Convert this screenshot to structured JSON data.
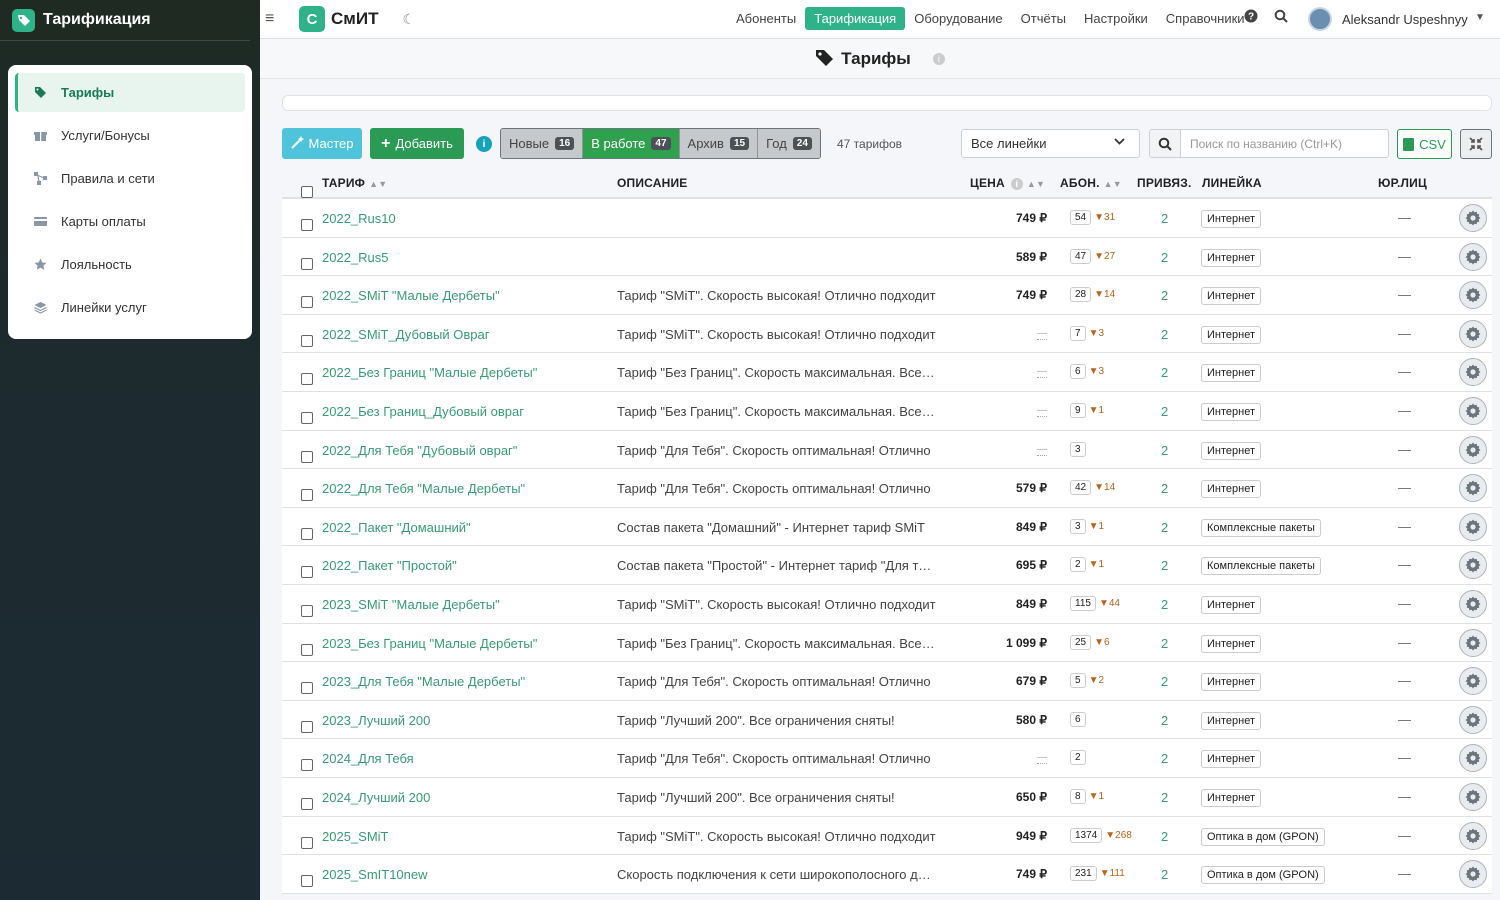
{
  "app": {
    "title": "Тарификация",
    "logo_letter": "С",
    "logo_text": "СмИТ"
  },
  "sidebar": {
    "items": [
      {
        "label": "Тарифы",
        "icon": "tag-icon",
        "active": true
      },
      {
        "label": "Услуги/Бонусы",
        "icon": "gift-icon"
      },
      {
        "label": "Правила и сети",
        "icon": "network-icon"
      },
      {
        "label": "Карты оплаты",
        "icon": "card-icon"
      },
      {
        "label": "Лояльность",
        "icon": "star-icon"
      },
      {
        "label": "Линейки услуг",
        "icon": "layers-icon"
      }
    ]
  },
  "nav": {
    "links": [
      "Абоненты",
      "Тарификация",
      "Оборудование",
      "Отчёты",
      "Настройки",
      "Справочники"
    ],
    "active": "Тарификация",
    "user": "Aleksandr Uspeshnyy"
  },
  "page": {
    "title": "Тарифы"
  },
  "toolbar": {
    "master_label": "Мастер",
    "add_label": "Добавить",
    "segments": [
      {
        "label": "Новые",
        "count": "16"
      },
      {
        "label": "В работе",
        "count": "47",
        "active": true
      },
      {
        "label": "Архив",
        "count": "15"
      },
      {
        "label": "Год",
        "count": "24"
      }
    ],
    "count_text": "47 тарифов",
    "line_select": "Все линейки",
    "search_placeholder": "Поиск по названию (Ctrl+K)",
    "csv_label": "CSV"
  },
  "table": {
    "headers": {
      "name": "ТАРИФ",
      "desc": "ОПИСАНИЕ",
      "price": "ЦЕНА",
      "subs": "АБОН.",
      "links": "ПРИВЯЗ.",
      "line": "ЛИНЕЙКА",
      "jur": "ЮР.ЛИЦ"
    },
    "rows": [
      {
        "name": "2022_Rus10",
        "desc": "",
        "price": "749 ₽",
        "subs": "54",
        "down": "▼31",
        "links": "2",
        "line": "Интернет",
        "jur": "—"
      },
      {
        "name": "2022_Rus5",
        "desc": "",
        "price": "589 ₽",
        "subs": "47",
        "down": "▼27",
        "links": "2",
        "line": "Интернет",
        "jur": "—"
      },
      {
        "name": "2022_SMiT \"Малые Дербеты\"",
        "desc": "Тариф \"SMiT\". Скорость высокая! Отлично подходит",
        "price": "749 ₽",
        "subs": "28",
        "down": "▼14",
        "links": "2",
        "line": "Интернет",
        "jur": "—"
      },
      {
        "name": "2022_SMiT_Дубовый Овраг",
        "desc": "Тариф \"SMiT\". Скорость высокая! Отлично подходит",
        "price": "—",
        "subs": "7",
        "down": "▼3",
        "links": "2",
        "line": "Интернет",
        "jur": "—"
      },
      {
        "name": "2022_Без Границ \"Малые Дербеты\"",
        "desc": "Тариф \"Без Границ\". Скорость максимальная. Все ограничения",
        "price": "—",
        "subs": "6",
        "down": "▼3",
        "links": "2",
        "line": "Интернет",
        "jur": "—"
      },
      {
        "name": "2022_Без Границ_Дубовый овраг",
        "desc": "Тариф \"Без Границ\". Скорость максимальная. Все ограничения",
        "price": "—",
        "subs": "9",
        "down": "▼1",
        "links": "2",
        "line": "Интернет",
        "jur": "—"
      },
      {
        "name": "2022_Для Тебя \"Дубовый овраг\"",
        "desc": "Тариф \"Для Тебя\". Скорость оптимальная! Отлично",
        "price": "—",
        "subs": "3",
        "down": "",
        "links": "2",
        "line": "Интернет",
        "jur": "—"
      },
      {
        "name": "2022_Для Тебя \"Малые Дербеты\"",
        "desc": "Тариф \"Для Тебя\". Скорость оптимальная! Отлично",
        "price": "579 ₽",
        "subs": "42",
        "down": "▼14",
        "links": "2",
        "line": "Интернет",
        "jur": "—"
      },
      {
        "name": "2022_Пакет \"Домашний\"",
        "desc": "Состав пакета \"Домашний\" - Интернет тариф SMiT",
        "price": "849 ₽",
        "subs": "3",
        "down": "▼1",
        "links": "2",
        "line": "Комплексные пакеты",
        "jur": "—"
      },
      {
        "name": "2022_Пакет \"Простой\"",
        "desc": "Состав пакета \"Простой\" - Интернет тариф \"Для тебя\"",
        "price": "695 ₽",
        "subs": "2",
        "down": "▼1",
        "links": "2",
        "line": "Комплексные пакеты",
        "jur": "—"
      },
      {
        "name": "2023_SMiT \"Малые Дербеты\"",
        "desc": "Тариф \"SMiT\". Скорость высокая! Отлично подходит",
        "price": "849 ₽",
        "subs": "115",
        "down": "▼44",
        "links": "2",
        "line": "Интернет",
        "jur": "—"
      },
      {
        "name": "2023_Без Границ \"Малые Дербеты\"",
        "desc": "Тариф \"Без Границ\". Скорость максимальная. Все ограничения",
        "price": "1 099 ₽",
        "subs": "25",
        "down": "▼6",
        "links": "2",
        "line": "Интернет",
        "jur": "—"
      },
      {
        "name": "2023_Для Тебя \"Малые Дербеты\"",
        "desc": "Тариф \"Для Тебя\". Скорость оптимальная! Отлично",
        "price": "679 ₽",
        "subs": "5",
        "down": "▼2",
        "links": "2",
        "line": "Интернет",
        "jur": "—"
      },
      {
        "name": "2023_Лучший 200",
        "desc": "Тариф \"Лучший 200\". Все ограничения сняты!",
        "price": "580 ₽",
        "subs": "6",
        "down": "",
        "links": "2",
        "line": "Интернет",
        "jur": "—"
      },
      {
        "name": "2024_Для Тебя",
        "desc": "Тариф \"Для Тебя\". Скорость оптимальная! Отлично",
        "price": "—",
        "subs": "2",
        "down": "",
        "links": "2",
        "line": "Интернет",
        "jur": "—"
      },
      {
        "name": "2024_Лучший 200",
        "desc": "Тариф \"Лучший 200\". Все ограничения сняты!",
        "price": "650 ₽",
        "subs": "8",
        "down": "▼1",
        "links": "2",
        "line": "Интернет",
        "jur": "—"
      },
      {
        "name": "2025_SMiT",
        "desc": "Тариф \"SMiT\". Скорость высокая! Отлично подходит",
        "price": "949 ₽",
        "subs": "1374",
        "down": "▼268",
        "links": "2",
        "line": "Оптика в дом (GPON)",
        "jur": "—"
      },
      {
        "name": "2025_SmIT10new",
        "desc": "Скорость подключения к сети широкополосного доступа",
        "price": "749 ₽",
        "subs": "231",
        "down": "▼111",
        "links": "2",
        "line": "Оптика в дом (GPON)",
        "jur": "—"
      }
    ]
  }
}
